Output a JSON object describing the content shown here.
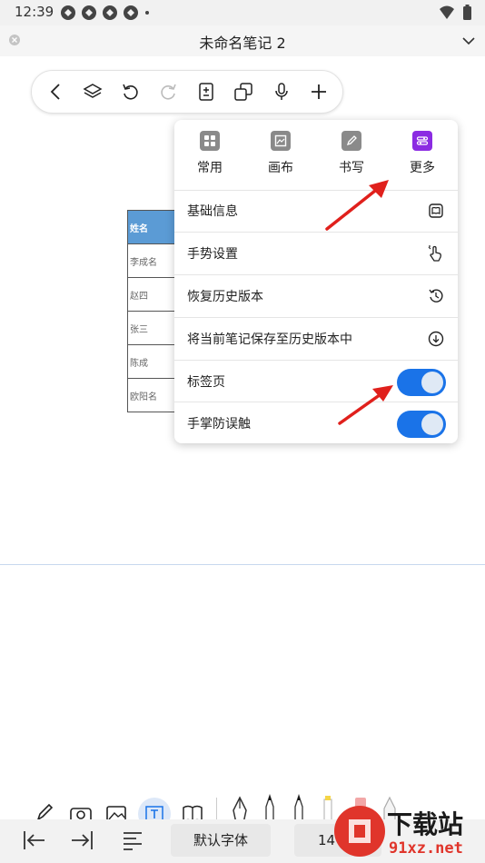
{
  "status_bar": {
    "time": "12:39"
  },
  "title_bar": {
    "title": "未命名笔记 2"
  },
  "table": {
    "header": "姓名",
    "rows": [
      "李成名",
      "赵四",
      "张三",
      "陈成",
      "欧阳名"
    ]
  },
  "menu": {
    "tabs": [
      {
        "label": "常用",
        "icon": "grid-icon"
      },
      {
        "label": "画布",
        "icon": "canvas-icon"
      },
      {
        "label": "书写",
        "icon": "pen-icon"
      },
      {
        "label": "更多",
        "icon": "more-settings-icon",
        "active": true
      }
    ],
    "items": [
      {
        "label": "基础信息",
        "icon": "book-icon"
      },
      {
        "label": "手势设置",
        "icon": "gesture-icon"
      },
      {
        "label": "恢复历史版本",
        "icon": "history-icon"
      },
      {
        "label": "将当前笔记保存至历史版本中",
        "icon": "download-circle-icon"
      },
      {
        "label": "标签页",
        "toggle": true,
        "value": "on"
      },
      {
        "label": "手掌防误触",
        "toggle": true,
        "value": "on"
      }
    ]
  },
  "bottom_bar": {
    "font": "默认字体",
    "size": "14"
  },
  "watermark": {
    "text": "下载站",
    "sub": "91xz.net"
  },
  "colors": {
    "accent": "#1a73e8",
    "active_tab": "#8b2be2",
    "table_header": "#5b9bd5",
    "arrow": "#e0201c"
  }
}
